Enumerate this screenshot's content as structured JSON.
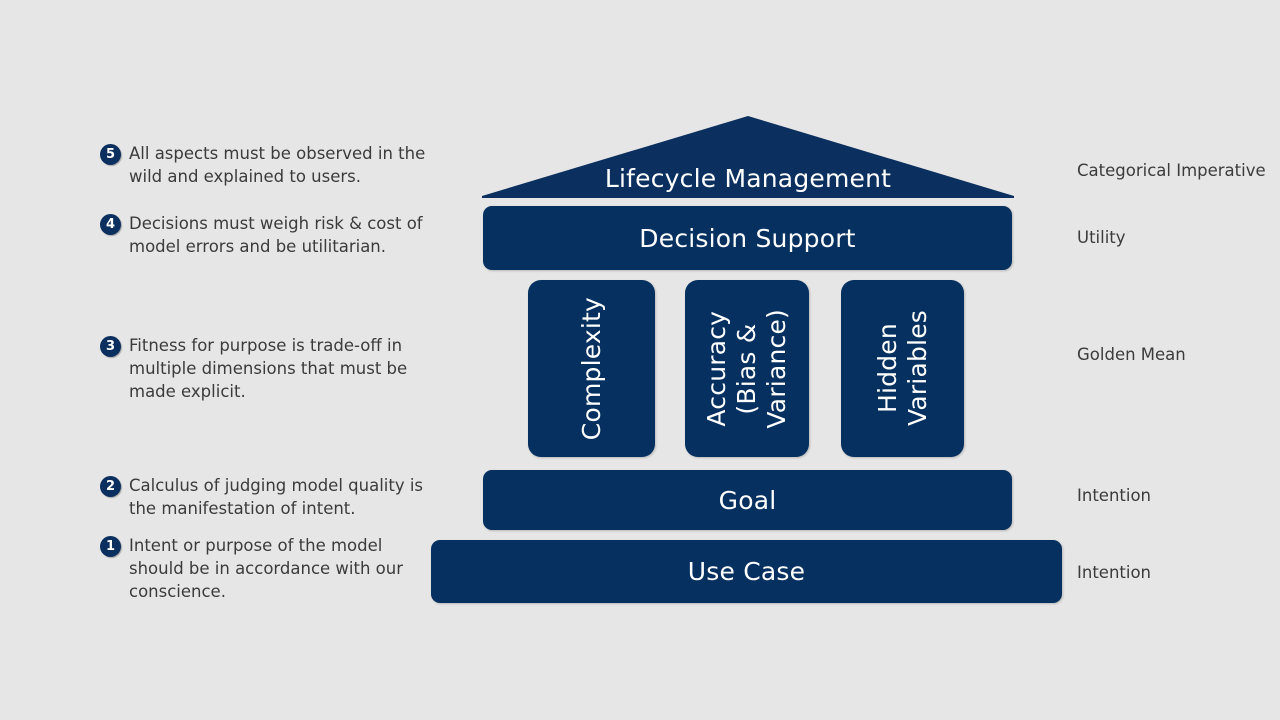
{
  "canvas": {
    "background_color": "#e6e6e6",
    "accent_color": "#06305f",
    "text_color": "#3b3b3b",
    "label_text_color": "#ffffff"
  },
  "notes": [
    {
      "number": "5",
      "text": "All aspects must be observed in the wild and explained to users."
    },
    {
      "number": "4",
      "text": "Decisions must weigh risk & cost of model errors and be utilitarian."
    },
    {
      "number": "3",
      "text": "Fitness for purpose is trade-off in multiple dimensions that must be made explicit."
    },
    {
      "number": "2",
      "text": "Calculus of judging model quality is the manifestation of intent."
    },
    {
      "number": "1",
      "text": "Intent or purpose of the model should be in accordance with our conscience."
    }
  ],
  "temple": {
    "pediment": {
      "label": "Lifecycle Management"
    },
    "entablature": {
      "label": "Decision Support"
    },
    "columns": [
      {
        "label": "Complexity"
      },
      {
        "label": "Accuracy\n(Bias &\nVariance)"
      },
      {
        "label": "Hidden\nVariables"
      }
    ],
    "stylobate": {
      "label": "Goal"
    },
    "foundation": {
      "label": "Use Case"
    }
  },
  "virtues": [
    {
      "label": "Categorical Imperative"
    },
    {
      "label": "Utility"
    },
    {
      "label": "Golden Mean"
    },
    {
      "label": "Intention"
    },
    {
      "label": "Intention"
    }
  ]
}
